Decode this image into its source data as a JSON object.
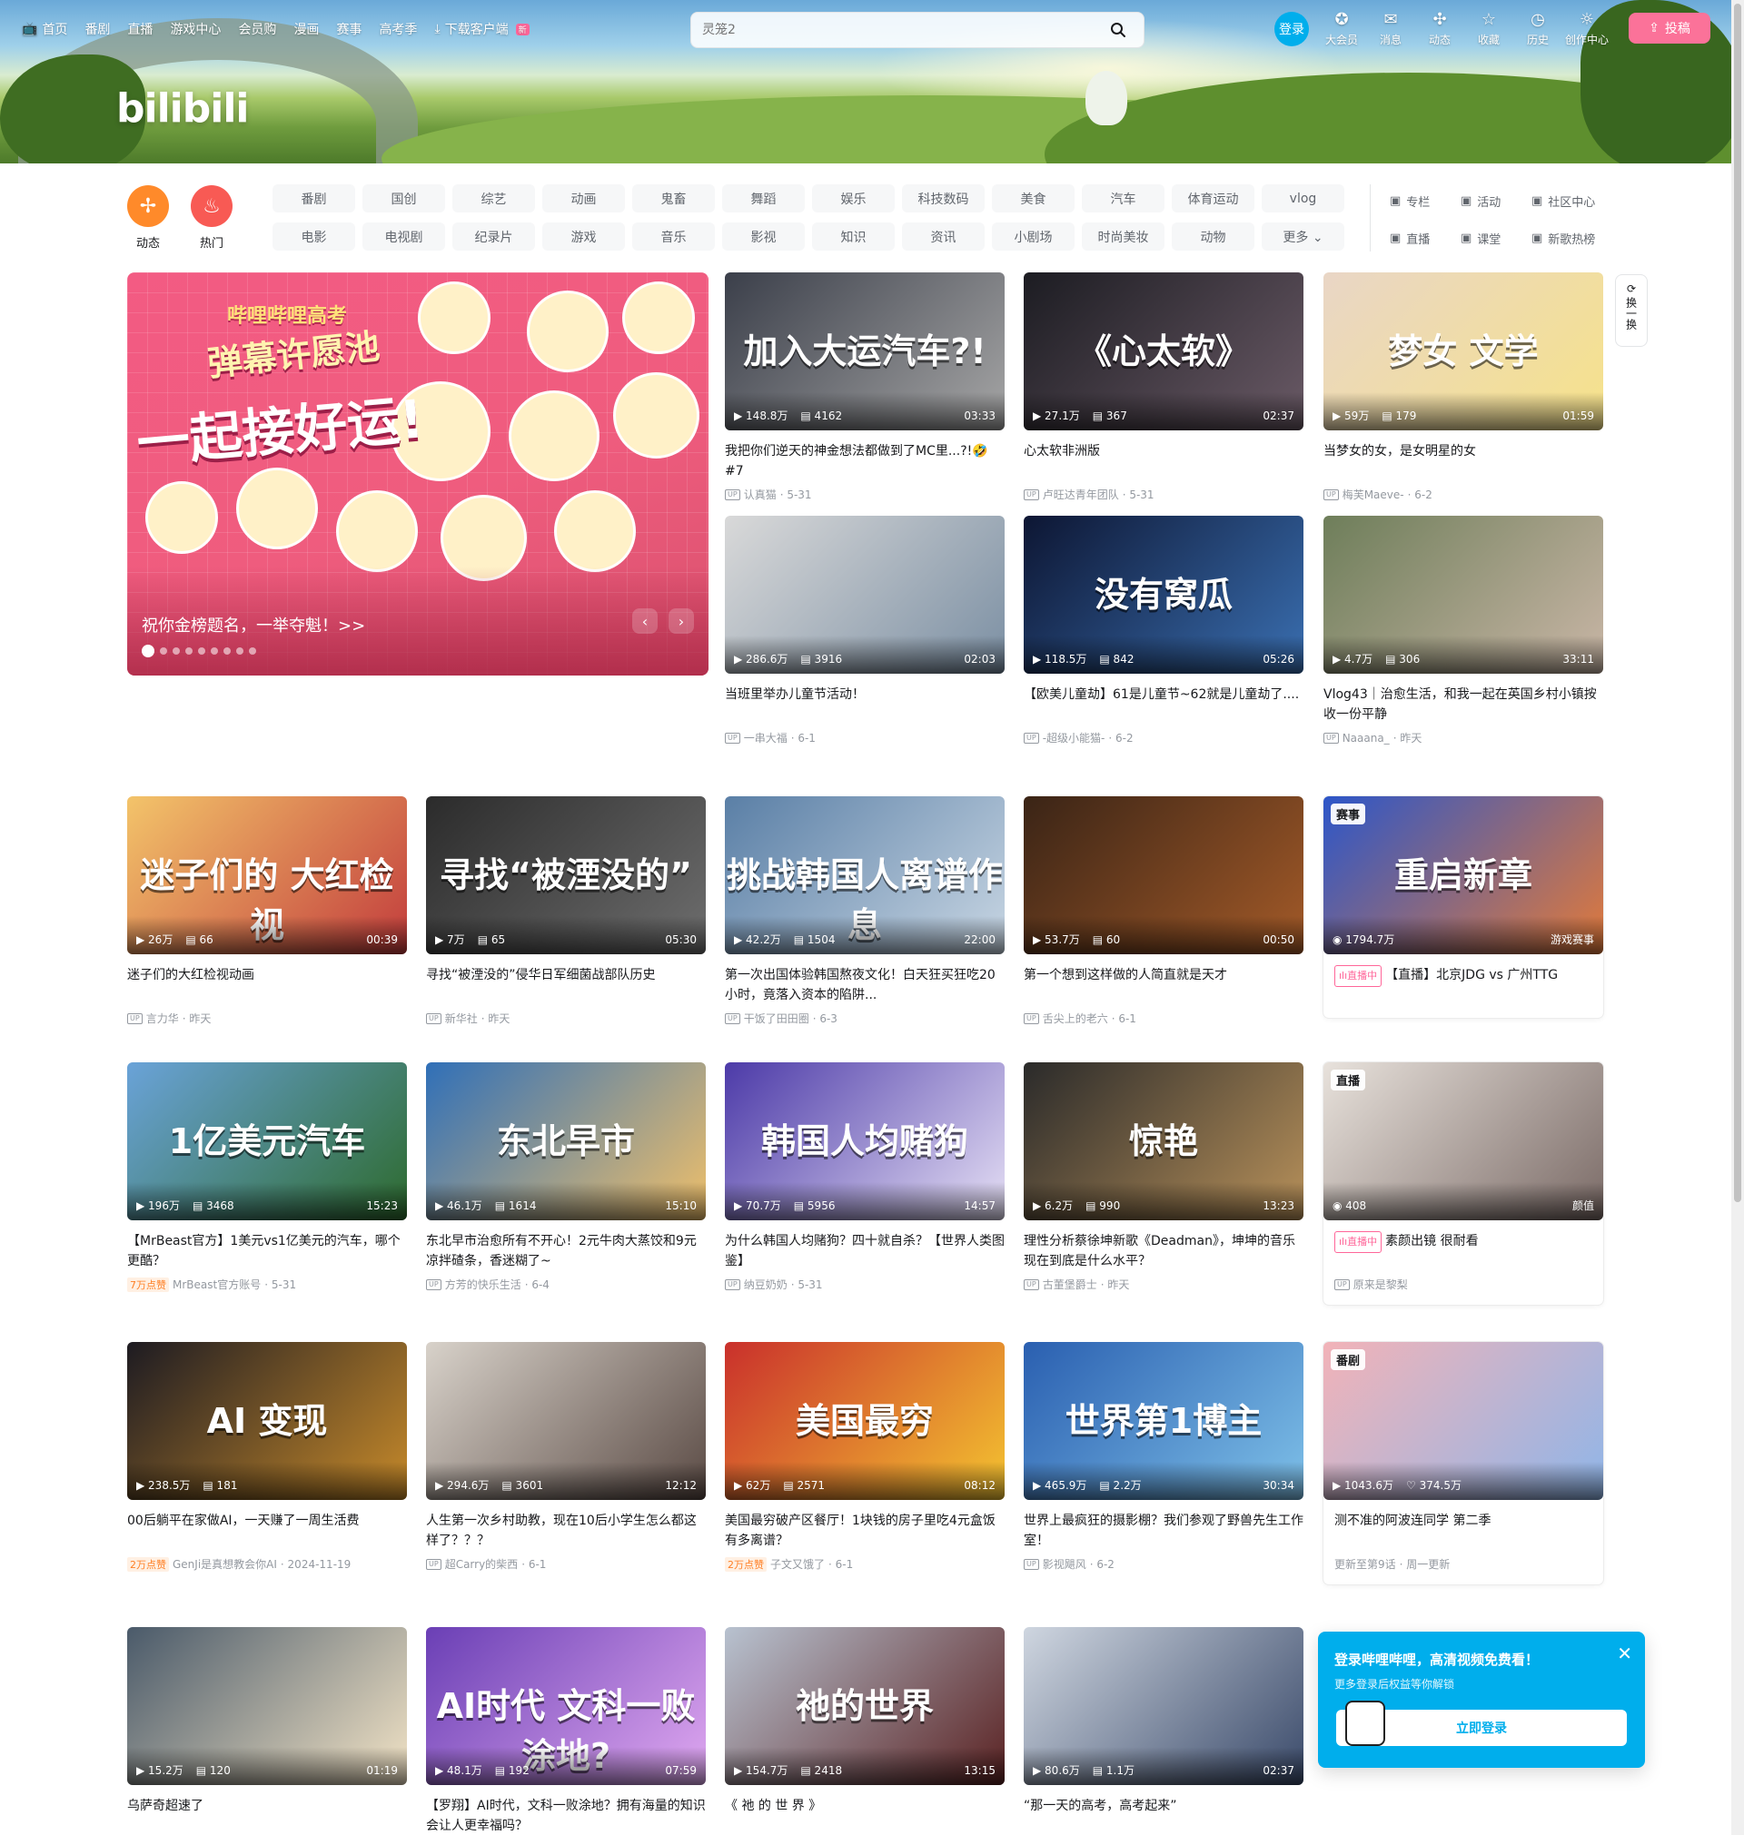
{
  "header": {
    "nav": [
      {
        "icon": "tv-icon",
        "label": "首页"
      },
      {
        "label": "番剧"
      },
      {
        "label": "直播"
      },
      {
        "label": "游戏中心"
      },
      {
        "label": "会员购"
      },
      {
        "label": "漫画"
      },
      {
        "label": "赛事"
      },
      {
        "label": "高考季"
      },
      {
        "icon": "download-icon",
        "label": "下载客户端",
        "badge": "新"
      }
    ],
    "logo": "bilibili",
    "search": {
      "placeholder": "灵笼2"
    },
    "login_label": "登录",
    "entries": [
      {
        "icon": "vip-icon",
        "label": "大会员"
      },
      {
        "icon": "message-icon",
        "label": "消息"
      },
      {
        "icon": "dynamic-icon",
        "label": "动态"
      },
      {
        "icon": "star-icon",
        "label": "收藏"
      },
      {
        "icon": "history-icon",
        "label": "历史"
      },
      {
        "icon": "bulb-icon",
        "label": "创作中心"
      }
    ],
    "upload_label": "投稿"
  },
  "channels": {
    "dynamic_label": "动态",
    "hot_label": "热门",
    "tags": [
      "番剧",
      "国创",
      "综艺",
      "动画",
      "鬼畜",
      "舞蹈",
      "娱乐",
      "科技数码",
      "美食",
      "汽车",
      "体育运动",
      "vlog",
      "电影",
      "电视剧",
      "纪录片",
      "游戏",
      "音乐",
      "影视",
      "知识",
      "资讯",
      "小剧场",
      "时尚美妆",
      "动物",
      "更多"
    ],
    "links": [
      {
        "icon": "column-icon",
        "label": "专栏"
      },
      {
        "icon": "flag-icon",
        "label": "活动"
      },
      {
        "icon": "community-icon",
        "label": "社区中心"
      },
      {
        "icon": "live-icon",
        "label": "直播"
      },
      {
        "icon": "classroom-icon",
        "label": "课堂"
      },
      {
        "icon": "music-icon",
        "label": "新歌热榜"
      }
    ]
  },
  "carousel": {
    "caption": "祝你金榜题名，一举夺魁！>>",
    "line1": "哔哩哔哩高考",
    "line2": "弹幕许愿池",
    "line3": "一起接好运!",
    "dots": 9,
    "active_dot": 0
  },
  "refresh_label": "换一换",
  "videos": [
    {
      "title": "我把你们逆天的神金想法都做到了MC里...?!🤣 #7",
      "views": "148.8万",
      "danmaku": "4162",
      "duration": "03:33",
      "up": "认真猫",
      "date": "5-31",
      "thumb_text": "加入大运汽车?!",
      "c1": "#3b3f4a",
      "c2": "#a6a6a6"
    },
    {
      "title": "心太软非洲版",
      "views": "27.1万",
      "danmaku": "367",
      "duration": "02:37",
      "up": "卢旺达青年团队",
      "date": "5-31",
      "thumb_text": "《心太软》",
      "c1": "#1c1c22",
      "c2": "#6a5a66"
    },
    {
      "title": "当梦女的女，是女明星的女",
      "views": "59万",
      "danmaku": "179",
      "duration": "01:59",
      "up": "梅芙Maeve-",
      "date": "6-2",
      "thumb_text": "梦女 文学",
      "c1": "#e9d6c6",
      "c2": "#f6e28a"
    },
    {
      "title": "当班里举办儿童节活动！",
      "views": "286.6万",
      "danmaku": "3916",
      "duration": "02:03",
      "up": "一串大福",
      "date": "6-1",
      "thumb_text": "",
      "c1": "#d9d9d9",
      "c2": "#7b8fa3"
    },
    {
      "title": "【欧美儿童劫】61是儿童节~62就是儿童劫了....",
      "views": "118.5万",
      "danmaku": "842",
      "duration": "05:26",
      "up": "-超级小能猫-",
      "date": "6-2",
      "thumb_text": "没有窝瓜",
      "c1": "#0d1633",
      "c2": "#3a6fb1"
    },
    {
      "title": "Vlog43｜治愈生活，和我一起在英国乡村小镇按收一份平静",
      "views": "4.7万",
      "danmaku": "306",
      "duration": "33:11",
      "up": "Naaana_",
      "date": "昨天",
      "thumb_text": "",
      "c1": "#6e7e5a",
      "c2": "#c9b6a6"
    },
    {
      "title": "迷子们的大红检视动画",
      "views": "26万",
      "danmaku": "66",
      "duration": "00:39",
      "up": "言力华",
      "date": "昨天",
      "thumb_text": "迷子们的 大红检视",
      "c1": "#f3c46a",
      "c2": "#c23c3c"
    },
    {
      "title": "寻找“被湮没的”侵华日军细菌战部队历史",
      "views": "7万",
      "danmaku": "65",
      "duration": "05:30",
      "up": "新华社",
      "date": "昨天",
      "thumb_text": "寻找“被湮没的”",
      "c1": "#2b2b2b",
      "c2": "#6e6e6e"
    },
    {
      "title": "第一次出国体验韩国熬夜文化！白天狂买狂吃20小时，竟落入资本的陷阱...",
      "views": "42.2万",
      "danmaku": "1504",
      "duration": "22:00",
      "up": "干饭了田田圈",
      "date": "6-3",
      "thumb_text": "挑战韩国人离谱作息",
      "c1": "#5a7fa6",
      "c2": "#c8d6e3"
    },
    {
      "title": "第一个想到这样做的人简直就是天才",
      "views": "53.7万",
      "danmaku": "60",
      "duration": "00:50",
      "up": "舌尖上的老六",
      "date": "6-1",
      "thumb_text": "",
      "c1": "#3a2416",
      "c2": "#a35a28"
    },
    {
      "title": "【直播】北京JDG vs 广州TTG",
      "views": "1794.7万",
      "danmaku": "",
      "duration": "游戏赛事",
      "up": "",
      "date": "",
      "thumb_text": "重启新章",
      "c1": "#2c56c9",
      "c2": "#e27a3a",
      "special": "赛事",
      "live": true
    },
    {
      "title": "【MrBeast官方】1美元vs1亿美元的汽车，哪个更酷？",
      "views": "196万",
      "danmaku": "3468",
      "duration": "15:23",
      "up": "MrBeast官方账号",
      "date": "5-31",
      "thumb_text": "1亿美元汽车",
      "c1": "#6aa3d9",
      "c2": "#2d6a2d",
      "likes": "7万点赞"
    },
    {
      "title": "东北早市治愈所有不开心！2元牛肉大蒸饺和9元凉拌碴条，香迷糊了~",
      "views": "46.1万",
      "danmaku": "1614",
      "duration": "15:10",
      "up": "方芳的快乐生活",
      "date": "6-4",
      "thumb_text": "东北早市",
      "c1": "#2f6fb8",
      "c2": "#f0c06a"
    },
    {
      "title": "为什么韩国人均赌狗？四十就自杀？【世界人类图鉴】",
      "views": "70.7万",
      "danmaku": "5956",
      "duration": "14:57",
      "up": "纳豆奶奶",
      "date": "5-31",
      "thumb_text": "韩国人均赌狗",
      "c1": "#4c3aa8",
      "c2": "#e6e0f5"
    },
    {
      "title": "理性分析蔡徐坤新歌《Deadman》，坤坤的音乐现在到底是什么水平？",
      "views": "6.2万",
      "danmaku": "990",
      "duration": "13:23",
      "up": "古董堡爵士",
      "date": "昨天",
      "thumb_text": "惊艳",
      "c1": "#2a2a2a",
      "c2": "#b8915a"
    },
    {
      "title": "素颜出镜 很耐看",
      "views": "408",
      "danmaku": "",
      "duration": "颜值",
      "up": "原来是黎梨",
      "date": "",
      "thumb_text": "",
      "c1": "#e8e2dc",
      "c2": "#7a6a66",
      "special": "直播",
      "live": true
    },
    {
      "title": "00后躺平在家做AI，一天赚了一周生活费",
      "views": "238.5万",
      "danmaku": "181",
      "duration": "",
      "up": "GenJi是真想教会你AI",
      "date": "2024-11-19",
      "thumb_text": "AI 变现",
      "c1": "#1d1b22",
      "c2": "#c78a2a",
      "likes": "2万点赞"
    },
    {
      "title": "人生第一次乡村助教，现在10后小学生怎么都这样了？？？",
      "views": "294.6万",
      "danmaku": "3601",
      "duration": "12:12",
      "up": "超Carry的柴西",
      "date": "6-1",
      "thumb_text": "",
      "c1": "#d8d2ca",
      "c2": "#5a4a44"
    },
    {
      "title": "美国最穷破产区餐厅！1块钱的房子里吃4元盒饭有多离谱？",
      "views": "62万",
      "danmaku": "2571",
      "duration": "08:12",
      "up": "子文又饿了",
      "date": "6-1",
      "thumb_text": "美国最穷",
      "c1": "#c9302c",
      "c2": "#f4c430",
      "likes": "2万点赞"
    },
    {
      "title": "世界上最疯狂的摄影棚？我们参观了野兽先生工作室！",
      "views": "465.9万",
      "danmaku": "2.2万",
      "duration": "30:34",
      "up": "影视飓风",
      "date": "6-2",
      "thumb_text": "世界第1博主",
      "c1": "#2a5fb0",
      "c2": "#7ec0e8"
    },
    {
      "title": "测不准的阿波连同学 第二季",
      "views": "1043.6万",
      "danmaku": "374.5万",
      "duration": "",
      "up": "更新至第9话",
      "date": "周一更新",
      "thumb_text": "",
      "c1": "#f2b3b8",
      "c2": "#8fb5e8",
      "special": "番剧",
      "anime": true
    },
    {
      "title": "乌萨奇超速了",
      "views": "15.2万",
      "danmaku": "120",
      "duration": "01:19",
      "up": "",
      "date": "",
      "thumb_text": "",
      "c1": "#4a5a6a",
      "c2": "#f3e4c6"
    },
    {
      "title": "【罗翔】AI时代，文科一败涂地？拥有海量的知识会让人更幸福吗？",
      "views": "48.1万",
      "danmaku": "192",
      "duration": "07:59",
      "up": "",
      "date": "",
      "thumb_text": "AI时代 文科一败涂地?",
      "c1": "#6a3fb5",
      "c2": "#e0a8f0"
    },
    {
      "title": "《 祂 的 世 界 》",
      "views": "154.7万",
      "danmaku": "2418",
      "duration": "13:15",
      "up": "",
      "date": "",
      "thumb_text": "祂的世界",
      "c1": "#b8c2d0",
      "c2": "#5a2222"
    },
    {
      "title": "“那一天的高考，高考起来”",
      "views": "80.6万",
      "danmaku": "1.1万",
      "duration": "02:37",
      "up": "",
      "date": "",
      "thumb_text": "",
      "c1": "#cfd6e0",
      "c2": "#3a4a6a"
    }
  ],
  "login_popup": {
    "heading": "登录哔哩哔哩，高清视频免费看！",
    "sub": "更多登录后权益等你解锁",
    "button": "立即登录"
  }
}
